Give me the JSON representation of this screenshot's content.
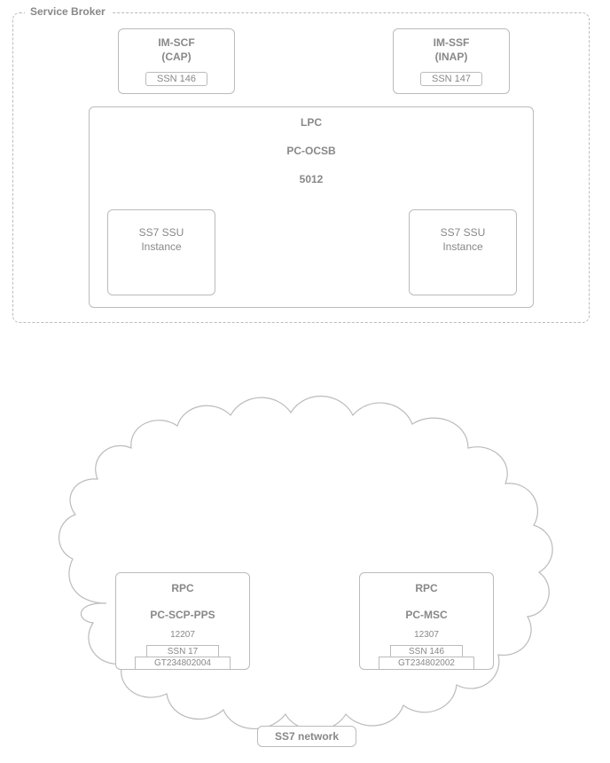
{
  "service_broker": {
    "title": "Service Broker",
    "im_scf": {
      "line1": "IM-SCF",
      "line2": "(CAP)",
      "ssn": "SSN 146"
    },
    "im_ssf": {
      "line1": "IM-SSF",
      "line2": "(INAP)",
      "ssn": "SSN 147"
    },
    "lpc": {
      "title": "LPC",
      "name": "PC-OCSB",
      "code": "5012",
      "ssu_left": {
        "line1": "SS7 SSU",
        "line2": "Instance"
      },
      "ssu_right": {
        "line1": "SS7 SSU",
        "line2": "Instance"
      }
    }
  },
  "ss7": {
    "network_label": "SS7 network",
    "rpc_left": {
      "title": "RPC",
      "name": "PC-SCP-PPS",
      "code": "12207",
      "ssn": "SSN 17",
      "gt": "GT234802004"
    },
    "rpc_right": {
      "title": "RPC",
      "name": "PC-MSC",
      "code": "12307",
      "ssn": "SSN 146",
      "gt": "GT234802002"
    }
  }
}
